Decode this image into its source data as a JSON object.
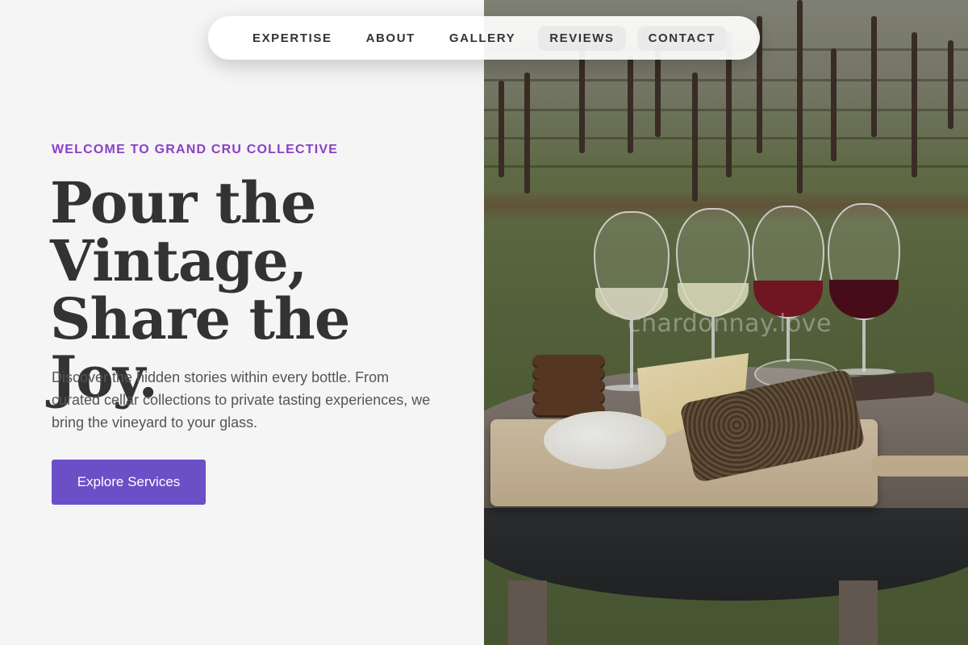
{
  "nav": {
    "items": [
      {
        "label": "EXPERTISE"
      },
      {
        "label": "ABOUT"
      },
      {
        "label": "GALLERY"
      },
      {
        "label": "REVIEWS"
      },
      {
        "label": "CONTACT"
      }
    ]
  },
  "hero": {
    "eyebrow": "WELCOME TO GRAND CRU COLLECTIVE",
    "headline": [
      "Pour the",
      "Vintage,",
      "Share the Joy."
    ],
    "description": "Discover the hidden stories within every bottle. From curated cellar collections to private tasting experiences, we bring the vineyard to your glass.",
    "cta_label": "Explore Services"
  },
  "photo": {
    "watermark": "chardonnay.love"
  },
  "colors": {
    "accent": "#6a4fc7",
    "eyebrow": "#8b3fc6",
    "text": "#333333",
    "background": "#f5f5f5"
  }
}
